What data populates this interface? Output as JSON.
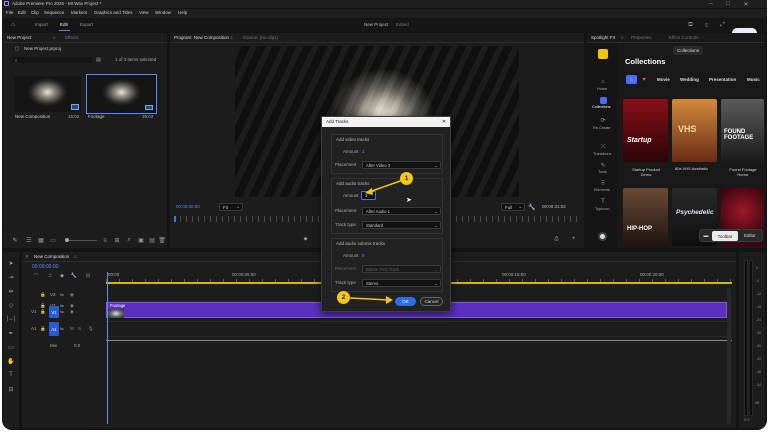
{
  "titlebar": {
    "title": "Adobe Premiere Pro 2025 - MI:Wav Project *"
  },
  "menu": [
    "File",
    "Edit",
    "Clip",
    "Sequence",
    "Markers",
    "Graphics and Titles",
    "View",
    "Window",
    "Help"
  ],
  "workspace": {
    "tabs": [
      "Import",
      "Edit",
      "Export"
    ],
    "center_title": "New Project",
    "center_sub": "Edited"
  },
  "project": {
    "tab": "New Project",
    "tab2": "Effects",
    "file": "New Project.prproj",
    "count": "1 of 3 items selected",
    "items": [
      {
        "name": "New Composition",
        "dur": "15:02"
      },
      {
        "name": "Footage",
        "dur": "35:03"
      }
    ]
  },
  "program": {
    "tab": "Program: New Composition",
    "tab2": "Source: (no clips)",
    "tc_left": "00:00:00:00",
    "fit": "Fit",
    "quality": "Full",
    "tc_right": "00:00:31:02"
  },
  "dialog": {
    "title": "Add Tracks",
    "video": {
      "header": "Add video tracks",
      "amount_label": "Amount",
      "amount": "1",
      "placement_label": "Placement",
      "placement": "After Video 3"
    },
    "audio": {
      "header": "Add audio tracks",
      "amount_label": "Amount",
      "amount": "1",
      "placement_label": "Placement",
      "placement": "After Audio 1",
      "type_label": "Track type",
      "type": "Standard"
    },
    "submix": {
      "header": "Add audio submix tracks",
      "amount_label": "Amount",
      "amount": "0",
      "placement_label": "Placement",
      "placement": "Before First Track",
      "type_label": "Track type",
      "type": "Stereo"
    },
    "ok": "OK",
    "cancel": "Cancel"
  },
  "callouts": [
    "1",
    "2"
  ],
  "spotlight": {
    "tab": "Spotlight FX",
    "tab2": "Properties",
    "tab3": "Effect Controls",
    "collections_btn": "Collections",
    "title": "Collections",
    "nav": [
      {
        "label": "Home",
        "icon": "home-icon"
      },
      {
        "label": "Collections",
        "icon": "collections-icon"
      },
      {
        "label": "Re-Create",
        "icon": "recreate-icon"
      },
      {
        "label": "Transitions",
        "icon": "transitions-icon"
      },
      {
        "label": "Tools",
        "icon": "tools-icon"
      },
      {
        "label": "Elements",
        "icon": "elements-icon"
      },
      {
        "label": "Typhoon",
        "icon": "typography-icon"
      }
    ],
    "filters": [
      "Movie",
      "Wedding",
      "Presentation",
      "Music"
    ],
    "cards": [
      {
        "art": "Startup",
        "caption": "Startup Product Demo"
      },
      {
        "art": "VHS",
        "caption": "80s VHS Aesthetic"
      },
      {
        "art": "FOUND FOOTAGE",
        "caption": "Found Footage Horror"
      },
      {
        "art": "HIP-HOP",
        "caption": ""
      },
      {
        "art": "Psychedelic",
        "caption": ""
      },
      {
        "art": "",
        "caption": ""
      }
    ],
    "toolbar_btn": "Toolbar",
    "editor_btn": "Editor",
    "colors": {
      "accent": "#4a6cff",
      "panel": "#1b1b1b"
    }
  },
  "timeline": {
    "tab": "New Composition",
    "tc": "00:00:00:00",
    "ruler": [
      "00:00",
      "00:00:05:00",
      "00:00:10:00",
      "00:00:15:00",
      "00:00:20:00"
    ],
    "tracks": {
      "v3": "V3",
      "v2": "V2",
      "v1": "V1",
      "a1": "A1",
      "mix": "Mix",
      "v1_src": "V1",
      "a1_src": "A1"
    },
    "clip_label": "Footage",
    "mix_value": "0.0"
  },
  "meter": {
    "labels": [
      "0",
      "-6",
      "-12",
      "-18",
      "-24",
      "-30",
      "-36",
      "-42",
      "-48",
      "-54",
      "dB"
    ],
    "ss": "S S"
  }
}
